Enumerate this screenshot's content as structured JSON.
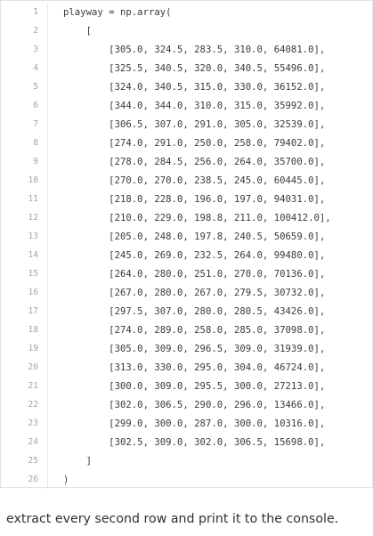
{
  "code": {
    "lines": [
      {
        "n": "1",
        "text": "playway = np.array("
      },
      {
        "n": "2",
        "text": "    ["
      },
      {
        "n": "3",
        "text": "        [305.0, 324.5, 283.5, 310.0, 64081.0],"
      },
      {
        "n": "4",
        "text": "        [325.5, 340.5, 320.0, 340.5, 55496.0],"
      },
      {
        "n": "5",
        "text": "        [324.0, 340.5, 315.0, 330.0, 36152.0],"
      },
      {
        "n": "6",
        "text": "        [344.0, 344.0, 310.0, 315.0, 35992.0],"
      },
      {
        "n": "7",
        "text": "        [306.5, 307.0, 291.0, 305.0, 32539.0],"
      },
      {
        "n": "8",
        "text": "        [274.0, 291.0, 250.0, 258.0, 79402.0],"
      },
      {
        "n": "9",
        "text": "        [278.0, 284.5, 256.0, 264.0, 35700.0],"
      },
      {
        "n": "10",
        "text": "        [270.0, 270.0, 238.5, 245.0, 60445.0],"
      },
      {
        "n": "11",
        "text": "        [218.0, 228.0, 196.0, 197.0, 94031.0],"
      },
      {
        "n": "12",
        "text": "        [210.0, 229.0, 198.8, 211.0, 100412.0],"
      },
      {
        "n": "13",
        "text": "        [205.0, 248.0, 197.8, 240.5, 50659.0],"
      },
      {
        "n": "14",
        "text": "        [245.0, 269.0, 232.5, 264.0, 99480.0],"
      },
      {
        "n": "15",
        "text": "        [264.0, 280.0, 251.0, 270.0, 70136.0],"
      },
      {
        "n": "16",
        "text": "        [267.0, 280.0, 267.0, 279.5, 30732.0],"
      },
      {
        "n": "17",
        "text": "        [297.5, 307.0, 280.0, 280.5, 43426.0],"
      },
      {
        "n": "18",
        "text": "        [274.0, 289.0, 258.0, 285.0, 37098.0],"
      },
      {
        "n": "19",
        "text": "        [305.0, 309.0, 296.5, 309.0, 31939.0],"
      },
      {
        "n": "20",
        "text": "        [313.0, 330.0, 295.0, 304.0, 46724.0],"
      },
      {
        "n": "21",
        "text": "        [300.0, 309.0, 295.5, 300.0, 27213.0],"
      },
      {
        "n": "22",
        "text": "        [302.0, 306.5, 290.0, 296.0, 13466.0],"
      },
      {
        "n": "23",
        "text": "        [299.0, 300.0, 287.0, 300.0, 10316.0],"
      },
      {
        "n": "24",
        "text": "        [302.5, 309.0, 302.0, 306.5, 15698.0],"
      },
      {
        "n": "25",
        "text": "    ]"
      },
      {
        "n": "26",
        "text": ")"
      }
    ]
  },
  "prompt": {
    "text": "extract every second row and print it to the console."
  }
}
